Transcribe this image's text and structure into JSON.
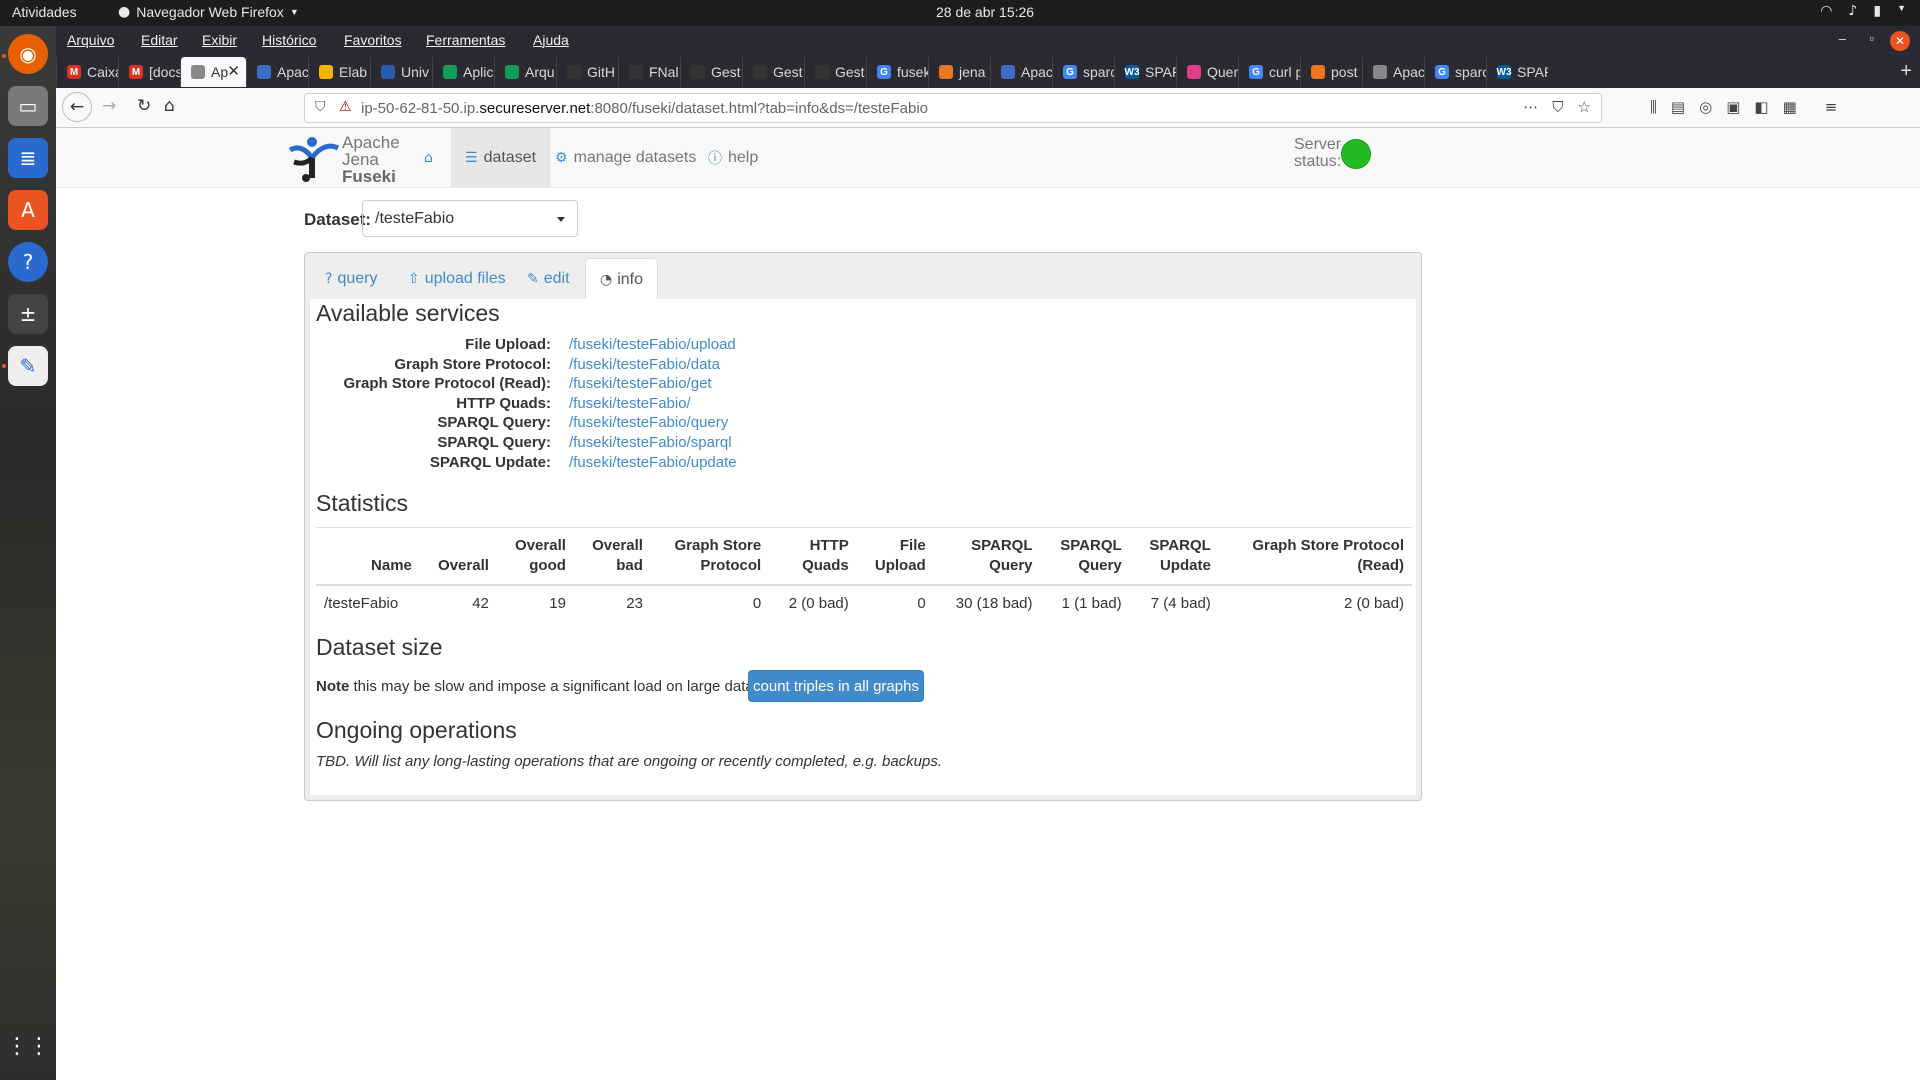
{
  "os": {
    "activities": "Atividades",
    "app_name": "Navegador Web Firefox",
    "clock": "28 de abr  15:26"
  },
  "browser": {
    "menu": [
      "Arquivo",
      "Editar",
      "Exibir",
      "Histórico",
      "Favoritos",
      "Ferramentas",
      "Ajuda"
    ],
    "tabs": [
      {
        "label": "Caixa",
        "fav_color": "#d93025",
        "fav": "M"
      },
      {
        "label": "[docs",
        "fav_color": "#d93025",
        "fav": "M"
      },
      {
        "label": "Ap",
        "fav_color": "#888888",
        "fav": "",
        "active": true
      },
      {
        "label": "Apac",
        "fav_color": "#3b6cc4",
        "fav": ""
      },
      {
        "label": "Elab",
        "fav_color": "#f4b400",
        "fav": ""
      },
      {
        "label": "Univ",
        "fav_color": "#2a5db0",
        "fav": ""
      },
      {
        "label": "Aplic",
        "fav_color": "#0f9d58",
        "fav": ""
      },
      {
        "label": "Arqu",
        "fav_color": "#0f9d58",
        "fav": ""
      },
      {
        "label": "GitH",
        "fav_color": "#333333",
        "fav": ""
      },
      {
        "label": "FNal",
        "fav_color": "#333333",
        "fav": ""
      },
      {
        "label": "Gest",
        "fav_color": "#333333",
        "fav": ""
      },
      {
        "label": "Gest",
        "fav_color": "#333333",
        "fav": ""
      },
      {
        "label": "Gest",
        "fav_color": "#333333",
        "fav": ""
      },
      {
        "label": "fusek",
        "fav_color": "#4285f4",
        "fav": "G"
      },
      {
        "label": "jena",
        "fav_color": "#e87722",
        "fav": ""
      },
      {
        "label": "Apac",
        "fav_color": "#3b6cc4",
        "fav": ""
      },
      {
        "label": "sparc",
        "fav_color": "#4285f4",
        "fav": "G"
      },
      {
        "label": "SPAR",
        "fav_color": "#005a9c",
        "fav": "W3"
      },
      {
        "label": "Quer",
        "fav_color": "#e03c8a",
        "fav": ""
      },
      {
        "label": "curl p",
        "fav_color": "#4285f4",
        "fav": "G"
      },
      {
        "label": "post",
        "fav_color": "#e87722",
        "fav": ""
      },
      {
        "label": "Apac",
        "fav_color": "#888888",
        "fav": ""
      },
      {
        "label": "sparc",
        "fav_color": "#4285f4",
        "fav": "G"
      },
      {
        "label": "SPAR",
        "fav_color": "#005a9c",
        "fav": "W3"
      }
    ],
    "url_prefix": "ip-50-62-81-50.ip.",
    "url_domain": "secureserver.net",
    "url_suffix": ":8080/fuseki/dataset.html?tab=info&ds=/testeFabio"
  },
  "fuseki": {
    "logo_lines": [
      "Apache",
      "Jena",
      "Fuseki"
    ],
    "nav": {
      "dataset": "dataset",
      "manage": "manage datasets",
      "help": "help"
    },
    "server_status_label": [
      "Server",
      "status:"
    ],
    "server_status_color": "#22bb22",
    "dataset_label": "Dataset:",
    "dataset_selected": "/testeFabio",
    "tabs": {
      "query": "query",
      "upload": "upload files",
      "edit": "edit",
      "info": "info"
    },
    "available_services_title": "Available services",
    "services": [
      {
        "label": "File Upload:",
        "link": "/fuseki/testeFabio/upload"
      },
      {
        "label": "Graph Store Protocol:",
        "link": "/fuseki/testeFabio/data"
      },
      {
        "label": "Graph Store Protocol (Read):",
        "link": "/fuseki/testeFabio/get"
      },
      {
        "label": "HTTP Quads:",
        "link": "/fuseki/testeFabio/"
      },
      {
        "label": "SPARQL Query:",
        "link": "/fuseki/testeFabio/query"
      },
      {
        "label": "SPARQL Query:",
        "link": "/fuseki/testeFabio/sparql"
      },
      {
        "label": "SPARQL Update:",
        "link": "/fuseki/testeFabio/update"
      }
    ],
    "statistics_title": "Statistics",
    "stats_headers": [
      [
        "Name"
      ],
      [
        "Overall"
      ],
      [
        "Overall",
        "good"
      ],
      [
        "Overall",
        "bad"
      ],
      [
        "Graph Store",
        "Protocol"
      ],
      [
        "HTTP",
        "Quads"
      ],
      [
        "File",
        "Upload"
      ],
      [
        "SPARQL",
        "Query"
      ],
      [
        "SPARQL",
        "Query"
      ],
      [
        "SPARQL",
        "Update"
      ],
      [
        "Graph Store Protocol",
        "(Read)"
      ]
    ],
    "stats_row": [
      "/testeFabio",
      "42",
      "19",
      "23",
      "0",
      "2 (0 bad)",
      "0",
      "30 (18 bad)",
      "1 (1 bad)",
      "7 (4 bad)",
      "2 (0 bad)"
    ],
    "dataset_size_title": "Dataset size",
    "note_bold": "Note",
    "note_text": " this may be slow and impose a significant load on large datasets:",
    "count_button": "count triples in all graphs",
    "ongoing_title": "Ongoing operations",
    "ongoing_text": "TBD. Will list any long-lasting operations that are ongoing or recently completed, e.g. backups."
  }
}
